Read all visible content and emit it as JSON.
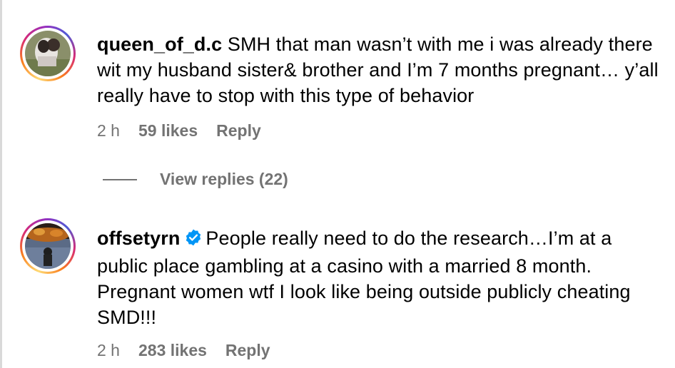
{
  "comments": [
    {
      "username": "queen_of_d.c",
      "verified": false,
      "text": "SMH that man wasn’t with me i was already there wit my husband sister& brother and I’m 7 months pregnant… y’all really have to stop with this type of behavior",
      "time": "2 h",
      "likes": "59 likes",
      "reply_label": "Reply",
      "avatar_icon": "profile-photo"
    },
    {
      "username": "offsetyrn",
      "verified": true,
      "text": "People really need to do the research…I’m at a public place gambling at a casino with a married 8 month. Pregnant women wtf I look like being outside publicly cheating SMD!!!",
      "time": "2 h",
      "likes": "283 likes",
      "reply_label": "Reply",
      "avatar_icon": "profile-photo"
    }
  ],
  "view_replies": "View replies (22)",
  "colors": {
    "meta_text": "#737373",
    "verified_badge": "#0095f6"
  }
}
